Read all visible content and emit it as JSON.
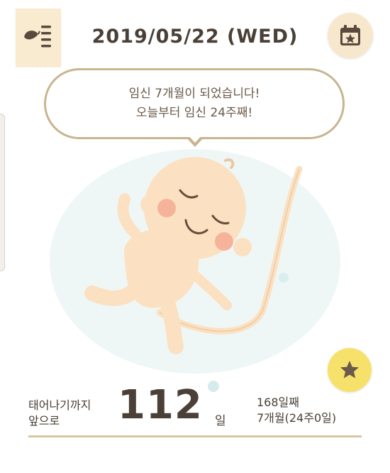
{
  "header": {
    "date": "2019/05/22 (WED)",
    "menu_icon": "leaf-menu-icon",
    "calendar_icon": "calendar-star-icon"
  },
  "bubble": {
    "line1": "임신 7개월이 되었습니다!",
    "line2": "오늘부터 임신 24주째!"
  },
  "illustration": {
    "subject": "baby-in-womb",
    "colors": {
      "womb": "#eef7f6",
      "skin": "#fbe1c2",
      "cheek": "#f5b39a"
    }
  },
  "actions": {
    "star_icon": "star-icon"
  },
  "countdown": {
    "label_line1": "태어나기까지",
    "label_line2": "앞으로",
    "days_left": "112",
    "unit": "일",
    "day_count": "168일째",
    "month_week": "7개월(24주0일)"
  },
  "colors": {
    "accent_gold": "#c9b491",
    "tab_bg": "#f8ebcf",
    "star_bg": "#f6e26a",
    "text": "#4a4037"
  }
}
